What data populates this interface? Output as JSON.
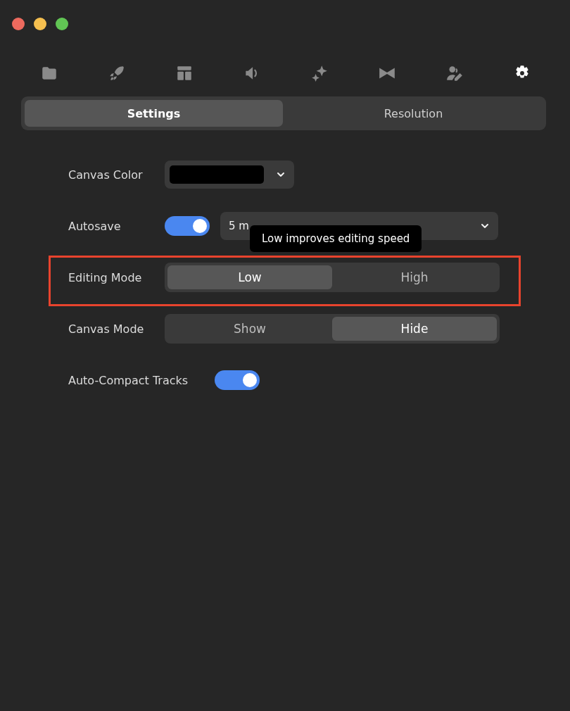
{
  "window": {
    "controls": [
      {
        "color": "#ed6a5e"
      },
      {
        "color": "#f5bf4f"
      },
      {
        "color": "#61c554"
      }
    ]
  },
  "toolbar": [
    {
      "selected": false
    },
    {
      "selected": false
    },
    {
      "selected": false
    },
    {
      "selected": false
    },
    {
      "selected": false
    },
    {
      "selected": false
    },
    {
      "selected": false
    },
    {
      "selected": true
    }
  ],
  "tabs": [
    {
      "label": "Settings",
      "selected": true
    },
    {
      "label": "Resolution",
      "selected": false
    }
  ],
  "settings": [
    {
      "kind": "color",
      "label": "Canvas Color",
      "color": "#000000"
    },
    {
      "kind": "toggle-dropdown",
      "label": "Autosave",
      "on": true,
      "value": "5 m"
    },
    {
      "kind": "segmented",
      "label": "Editing Mode",
      "highlighted": true,
      "options": [
        {
          "label": "Low",
          "selected": true
        },
        {
          "label": "High",
          "selected": false
        }
      ]
    },
    {
      "kind": "segmented",
      "label": "Canvas Mode",
      "options": [
        {
          "label": "Show",
          "selected": false
        },
        {
          "label": "Hide",
          "selected": true
        }
      ]
    },
    {
      "kind": "toggle",
      "label": "Auto-Compact Tracks",
      "on": true
    }
  ],
  "tooltip": {
    "text": "Low improves editing speed"
  }
}
